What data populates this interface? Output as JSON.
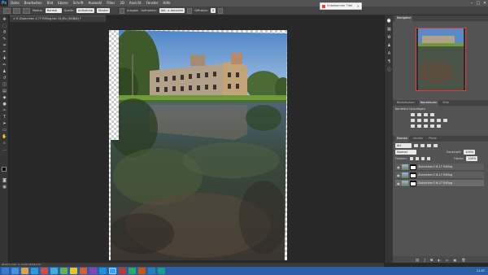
{
  "app": {
    "logo": "Ps"
  },
  "menu": {
    "items": [
      "Datei",
      "Bearbeiten",
      "Bild",
      "Ebene",
      "Schrift",
      "Auswahl",
      "Filter",
      "3D",
      "Ansicht",
      "Fenster",
      "Hilfe"
    ],
    "win_minimize": "–",
    "win_maximize": "□",
    "win_close": "✕"
  },
  "options_bar": {
    "modus_label": "Modus:",
    "modus_value": "Normal",
    "quelle_label": "Quelle:",
    "quelle_value": "Aufnahme",
    "muster_value": "Muster",
    "ausgew_label": "Ausgew.",
    "aufnahme_label": "Aufnahme:",
    "aufnahme_value": "Akt. u. darunter",
    "diffusion_label": "Diffusion:",
    "diffusion_value": "5"
  },
  "toast": {
    "text": "Unbekannter Titel",
    "close": "✕"
  },
  "document": {
    "tab_title": "R Zisterchen d 77 Rifling.tec 15,8% (RGB/8) *",
    "tab_close": "×"
  },
  "status": {
    "text": "66,67%   Dok: 2,1/100,75/34,5 M"
  },
  "panels": {
    "navigator_tab": "Navigator",
    "bibliotheken_tab": "Bibliotheken",
    "korrekturen_tab": "Korrekturen",
    "stile_tab": "Stile",
    "korrekturen_hint": "Korrektur hinzufügen",
    "ebenen_tab": "Ebenen",
    "kanaele_tab": "Kanäle",
    "pfade_tab": "Pfade",
    "filter_label": "Art",
    "blend_mode": "Normal",
    "opacity_label": "Deckkraft:",
    "opacity_value": "100%",
    "fixieren_label": "Fixieren:",
    "flaeche_label": "Fläche:",
    "flaeche_value": "100%",
    "layers": [
      {
        "name": "Zisterchen7-6-17 Rifling"
      },
      {
        "name": "Zisterchen7-6-17 Rifling"
      },
      {
        "name": "Zisterchen7-6-17 Rifling"
      }
    ]
  },
  "taskbar": {
    "time": "11:07"
  }
}
